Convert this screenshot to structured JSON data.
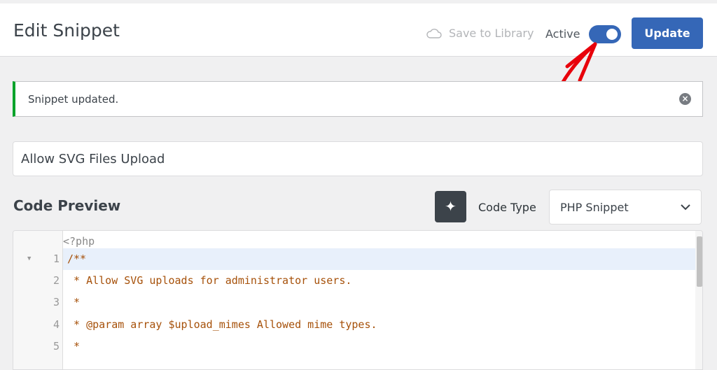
{
  "header": {
    "title": "Edit Snippet",
    "save_to_library": "Save to Library",
    "active_label": "Active",
    "active": true,
    "update": "Update"
  },
  "notice": {
    "text": "Snippet updated."
  },
  "snippet_title": "Allow SVG Files Upload",
  "code_preview": {
    "heading": "Code Preview",
    "code_type_label": "Code Type",
    "code_type_value": "PHP Snippet",
    "php_open": "<?php",
    "lines": [
      {
        "n": "1",
        "text": "/**"
      },
      {
        "n": "2",
        "text": " * Allow SVG uploads for administrator users."
      },
      {
        "n": "3",
        "text": " *"
      },
      {
        "n": "4",
        "text": " * @param array $upload_mimes Allowed mime types."
      },
      {
        "n": "5",
        "text": " *"
      }
    ]
  },
  "colors": {
    "accent": "#3567b7",
    "success": "#00a32a",
    "annotation": "#e8000b"
  }
}
